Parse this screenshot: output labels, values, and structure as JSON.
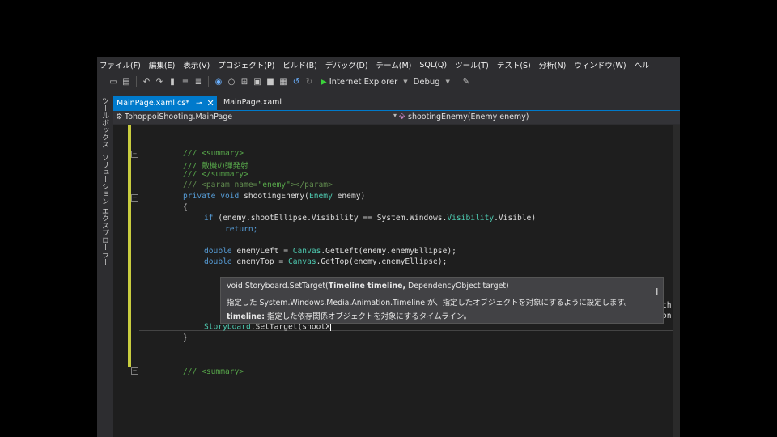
{
  "menu": [
    "ファイル(F)",
    "編集(E)",
    "表示(V)",
    "プロジェクト(P)",
    "ビルド(B)",
    "デバッグ(D)",
    "チーム(M)",
    "SQL(Q)",
    "ツール(T)",
    "テスト(S)",
    "分析(N)",
    "ウィンドウ(W)",
    "ヘル"
  ],
  "toolbar": {
    "browser": "Internet Explorer",
    "config": "Debug"
  },
  "sidebar": {
    "toolbox": "ツールボックス",
    "solution_explorer": "ソリューション エクスプローラー"
  },
  "tabs": {
    "active": "MainPage.xaml.cs*",
    "second": "MainPage.xaml"
  },
  "nav": {
    "class": "TohoppoiShooting.MainPage",
    "member": "shootingEnemy(Enemy enemy)"
  },
  "code": {
    "l1": "/// <summary>",
    "l2": "/// 敵機の弾発射",
    "l3": "/// </summary>",
    "l4a": "/// <param name=",
    "l4b": "\"enemy\"",
    "l4c": "></param>",
    "l5a": "private void ",
    "l5b": "shootingEnemy(",
    "l5c": "Enemy",
    "l5d": " enemy)",
    "l6": "{",
    "l7a": "if",
    "l7b": " (enemy.shootEllipse.Visibility == System.Windows.",
    "l7c": "Visibility",
    "l7d": ".Visible)",
    "l8": "return;",
    "l9a": "double",
    "l9b": " enemyLeft = ",
    "l9c": "Canvas",
    "l9d": ".GetLeft(enemy.enemyEllipse);",
    "l10a": "double",
    "l10b": " enemyTop = ",
    "l10c": "Canvas",
    "l10d": ".GetTop(enemy.enemyEllipse);",
    "l11a": "Storyboard",
    "l11b": ".SetTarget(shootX",
    "l12": "}",
    "l13": "/// <summary>",
    "clip1": "th), D",
    "clip2": "on = ("
  },
  "tooltip": {
    "sig_pre": "void Storyboard.SetTarget(",
    "sig_bold": "Timeline timeline,",
    "sig_post": " DependencyObject target)",
    "desc": "指定した System.Windows.Media.Animation.Timeline が、指定したオブジェクトを対象にするように設定します。",
    "param_name": "timeline:",
    "param_desc": " 指定した依存関係オブジェクトを対象にするタイムライン。"
  }
}
